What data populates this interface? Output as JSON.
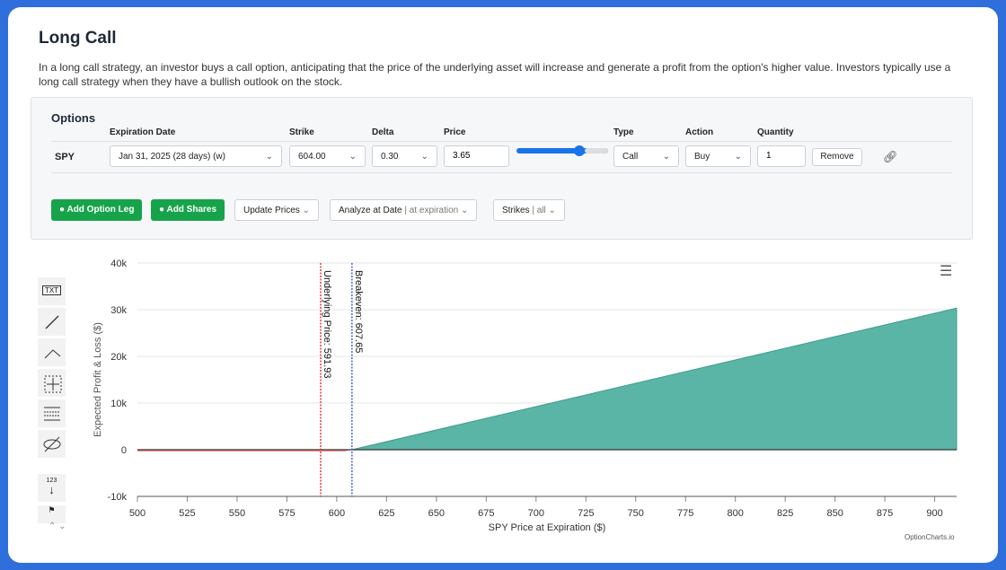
{
  "title": "Long Call",
  "description": "In a long call strategy, an investor buys a call option, anticipating that the price of the underlying asset will increase and generate a profit from the option's higher value. Investors typically use a long call strategy when they have a bullish outlook on the stock.",
  "options": {
    "title": "Options",
    "headers": {
      "expiration": "Expiration Date",
      "strike": "Strike",
      "delta": "Delta",
      "price": "Price",
      "type": "Type",
      "action": "Action",
      "quantity": "Quantity"
    },
    "leg": {
      "symbol": "SPY",
      "expiration": "Jan 31, 2025 (28 days) (w)",
      "strike": "604.00",
      "delta": "0.30",
      "price": "3.65",
      "type": "Call",
      "action": "Buy",
      "quantity": "1",
      "remove": "Remove",
      "slider_fraction": 0.8
    },
    "buttons": {
      "add_leg": "Add Option Leg",
      "add_shares": "Add Shares",
      "update_prices": "Update Prices",
      "analyze": "Analyze at Date",
      "analyze_value": "| at expiration",
      "strikes": "Strikes",
      "strikes_value": "| all"
    },
    "colors": {
      "accent": "#16a34a",
      "slider": "#1a73e8"
    }
  },
  "chart": {
    "credit": "OptionCharts.io",
    "tools": [
      "TXT",
      "123"
    ]
  },
  "chart_data": {
    "type": "area",
    "xlabel": "SPY Price at Expiration ($)",
    "ylabel": "Expected Profit & Loss ($)",
    "xlim": [
      500,
      911
    ],
    "ylim": [
      -10000,
      40000
    ],
    "xticks": [
      500,
      525,
      550,
      575,
      600,
      625,
      650,
      675,
      700,
      725,
      750,
      775,
      800,
      825,
      850,
      875,
      900
    ],
    "yticks": [
      {
        "v": 40000,
        "l": "40k"
      },
      {
        "v": 30000,
        "l": "30k"
      },
      {
        "v": 20000,
        "l": "20k"
      },
      {
        "v": 10000,
        "l": "10k"
      },
      {
        "v": 0,
        "l": "0"
      },
      {
        "v": -10000,
        "l": "-10k"
      }
    ],
    "series": [
      {
        "x": [
          500,
          604,
          607.65,
          911
        ],
        "y": [
          -365,
          -365,
          0,
          30335
        ]
      }
    ],
    "annotations": [
      {
        "label": "Underlying Price: 591.93",
        "x": 591.93,
        "color": "#e11d1d"
      },
      {
        "label": "Breakeven: 607.65",
        "x": 607.65,
        "color": "#2b4fc7"
      }
    ],
    "profit_color": "#5bb5a6",
    "loss_color": "#f08080",
    "grid": true
  }
}
